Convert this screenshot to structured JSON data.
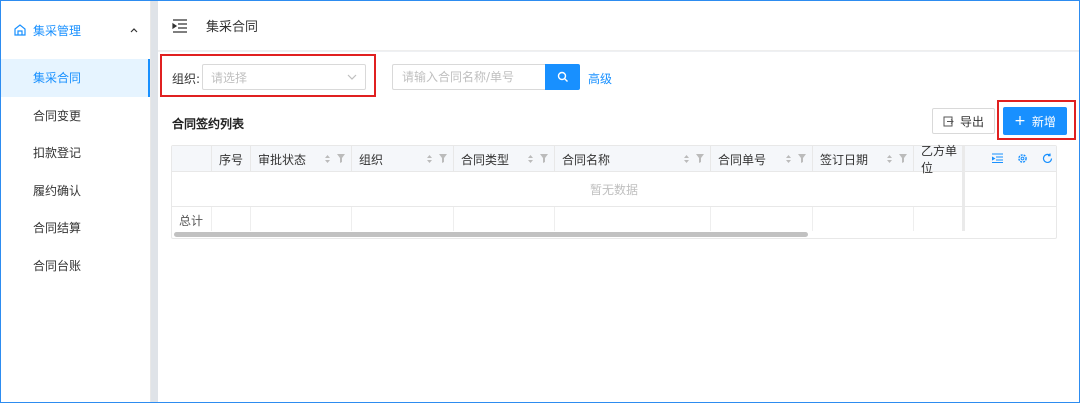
{
  "sidebar": {
    "group_label": "集采管理",
    "items": [
      {
        "label": "集采合同",
        "active": true
      },
      {
        "label": "合同变更"
      },
      {
        "label": "扣款登记"
      },
      {
        "label": "履约确认"
      },
      {
        "label": "合同结算"
      },
      {
        "label": "合同台账"
      }
    ]
  },
  "header": {
    "title": "集采合同"
  },
  "filter": {
    "org_label": "组织:",
    "org_placeholder": "请选择",
    "search_placeholder": "请输入合同名称/单号",
    "advanced_label": "高级"
  },
  "list": {
    "title": "合同签约列表",
    "export_label": "导出",
    "new_label": "新增",
    "columns": [
      "序号",
      "审批状态",
      "组织",
      "合同类型",
      "合同名称",
      "合同单号",
      "签订日期",
      "乙方单位"
    ],
    "empty_text": "暂无数据",
    "summary_label": "总计"
  },
  "colors": {
    "primary": "#1890ff",
    "highlight": "#e02020"
  }
}
